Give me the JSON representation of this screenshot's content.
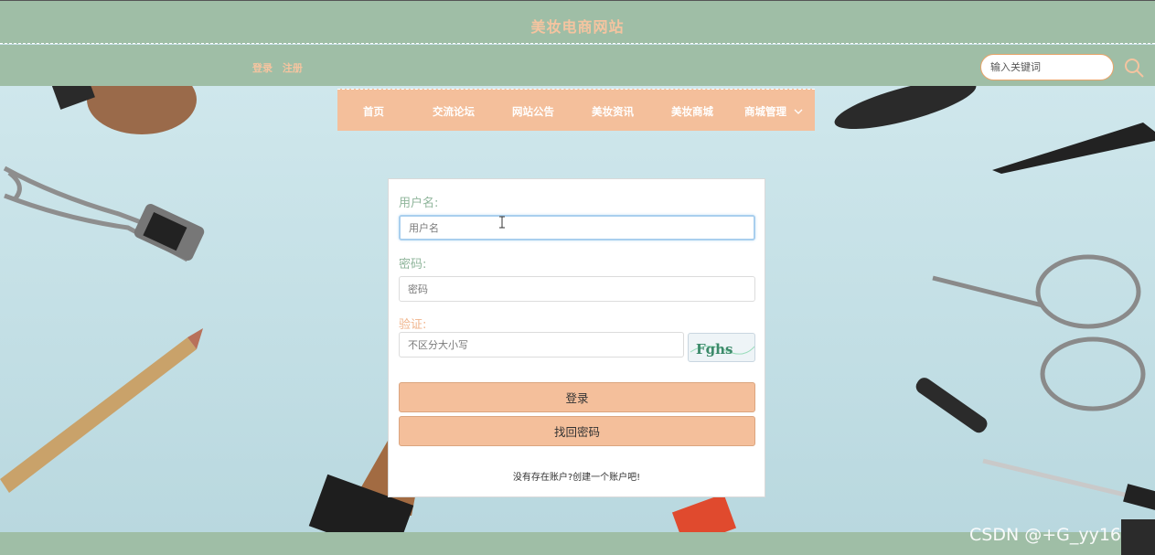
{
  "header": {
    "site_title": "美妆电商网站"
  },
  "auth": {
    "login_label": "登录",
    "register_label": "注册"
  },
  "search": {
    "placeholder": "输入关键词"
  },
  "nav": {
    "items": [
      {
        "label": "首页"
      },
      {
        "label": "交流论坛"
      },
      {
        "label": "网站公告"
      },
      {
        "label": "美妆资讯"
      },
      {
        "label": "美妆商城"
      },
      {
        "label": "商城管理"
      }
    ]
  },
  "login_form": {
    "username_label": "用户名:",
    "username_placeholder": "用户名",
    "password_label": "密码:",
    "password_placeholder": "密码",
    "captcha_label": "验证:",
    "captcha_placeholder": "不区分大小写",
    "captcha_text": "Fghs",
    "login_button": "登录",
    "recover_button": "找回密码",
    "register_prompt": "没有存在账户?创建一个账户吧!"
  },
  "watermark": "CSDN @+G_yy163",
  "colors": {
    "header_green": "#9fbea6",
    "accent_peach": "#f4bf9b",
    "title_peach": "#f5c4a0"
  }
}
